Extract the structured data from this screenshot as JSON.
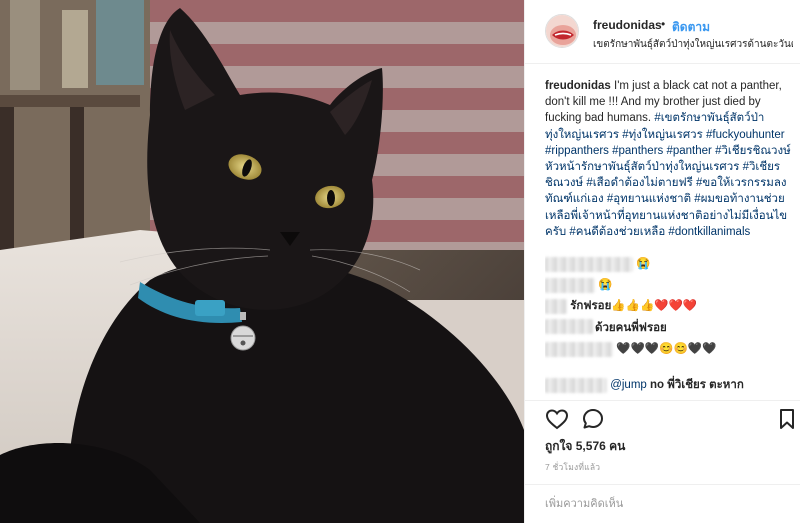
{
  "post": {
    "username": "freudonidas",
    "separator": "•",
    "follow_label": "ติดตาม",
    "location": "เขตรักษาพันธุ์สัตว์ป่าทุ่งใหญ่นเรศวรด้านตะวันตก",
    "caption_user": "freudonidas",
    "caption_text": "I'm just a black cat not a panther, don't kill me !!! And my brother just died by fucking bad humans.",
    "hashtags": "#เขตรักษาพันธุ์สัตว์ป่าทุ่งใหญ่นเรศวร #ทุ่งใหญ่นเรศวร #fuckyouhunter #rippanthers #panthers #panther #วิเชียรชิณวงษ์หัวหน้ารักษาพันธุ์สัตว์ป่าทุ่งใหญ่นเรศวร #วิเชียรชิณวงษ์ #เสือดำต้องไม่ตายฟรี #ขอให้เวรกรรมลงทัณฑ์แก่เอง #อุทยานแห่งชาติ #ผมขอท้างานช่วยเหลือพี่เจ้าหน้าที่อุทยานแห่งชาติอย่างไม่มีเงื่อนไขครับ #คนดีต้องช่วยเหลือ #dontkillanimals",
    "likes": "ถูกใจ 5,576 คน",
    "time": "7 ชั่วโมงที่แล้ว",
    "add_comment_placeholder": "เพิ่มความคิดเห็น"
  },
  "comments": [
    {
      "text": "😭"
    },
    {
      "text": "😭"
    },
    {
      "text": "รักฟรอย👍👍👍❤️❤️❤️"
    },
    {
      "text": "ด้วยคนพี่ฟรอย"
    },
    {
      "text": "🖤🖤🖤😊😊🖤🖤"
    },
    {
      "mention": "@jump",
      "text": "no พี่วิเชียร ตะหาก"
    }
  ],
  "icons": {
    "like": "heart-icon",
    "comment": "comment-bubble-icon",
    "save": "bookmark-icon"
  },
  "colors": {
    "link": "#3897f0",
    "hashtag": "#003569",
    "muted": "#999999",
    "heart": "#ed4956"
  }
}
